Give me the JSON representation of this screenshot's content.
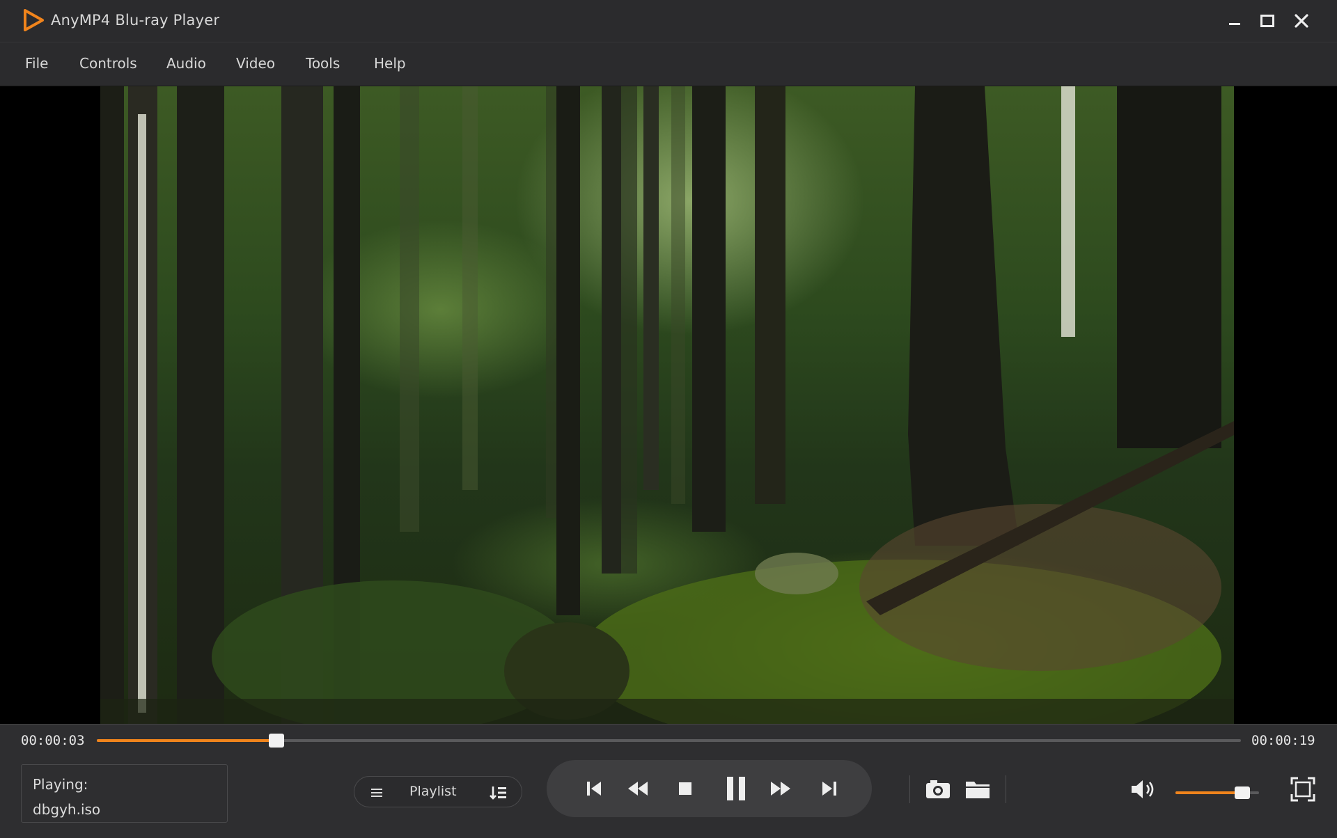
{
  "window": {
    "title": "AnyMP4 Blu-ray Player",
    "controls": [
      "minimize-icon",
      "maximize-icon",
      "close-icon"
    ]
  },
  "menu": {
    "items": [
      {
        "label": "File"
      },
      {
        "label": "Controls"
      },
      {
        "label": "Audio"
      },
      {
        "label": "Video"
      },
      {
        "label": "Tools"
      },
      {
        "label": "Help"
      }
    ]
  },
  "player": {
    "current_time": "00:00:03",
    "total_time": "00:00:19",
    "progress": 0.157,
    "now_playing_label": "Playing:",
    "now_playing_file": "dbgyh.iso",
    "playlist_label": "Playlist",
    "volume": 0.8,
    "accent_color": "#f0841c"
  },
  "icons": {
    "transport": [
      "skip-previous-icon",
      "rewind-icon",
      "stop-icon",
      "pause-icon",
      "fast-forward-icon",
      "skip-next-icon"
    ],
    "tools": [
      "snapshot-camera-icon",
      "open-folder-icon"
    ],
    "misc": [
      "volume-icon",
      "fullscreen-icon",
      "playlist-menu-icon",
      "playlist-sort-icon"
    ]
  }
}
